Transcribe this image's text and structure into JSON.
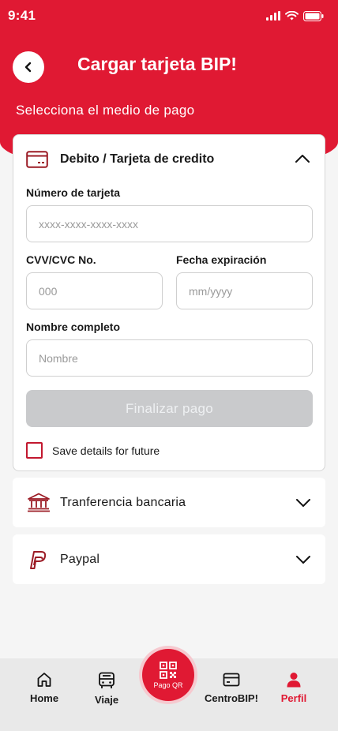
{
  "status": {
    "time": "9:41"
  },
  "header": {
    "title": "Cargar tarjeta BIP!",
    "subtitle": "Selecciona el medio de pago"
  },
  "card_section": {
    "title": "Debito / Tarjeta de credito",
    "card_number_label": "Número de tarjeta",
    "card_number_placeholder": "xxxx-xxxx-xxxx-xxxx",
    "cvv_label": "CVV/CVC No.",
    "cvv_placeholder": "000",
    "expiry_label": "Fecha expiración",
    "expiry_placeholder": "mm/yyyy",
    "name_label": "Nombre completo",
    "name_placeholder": "Nombre",
    "submit_label": "Finalizar pago",
    "save_label": "Save details for future"
  },
  "options": [
    {
      "label": "Tranferencia bancaria",
      "icon": "bank-icon"
    },
    {
      "label": "Paypal",
      "icon": "paypal-icon"
    }
  ],
  "nav": {
    "items": [
      {
        "label": "Home",
        "icon": "home-icon"
      },
      {
        "label": "Viaje",
        "icon": "bus-icon"
      },
      {
        "label": "CentroBIP!",
        "icon": "card-icon"
      },
      {
        "label": "Perfil",
        "icon": "user-icon",
        "active": true
      }
    ],
    "qr_label": "Pago QR"
  },
  "colors": {
    "accent": "#e01933",
    "background": "#f5f5f5",
    "disabled_button": "#c9cacc"
  }
}
